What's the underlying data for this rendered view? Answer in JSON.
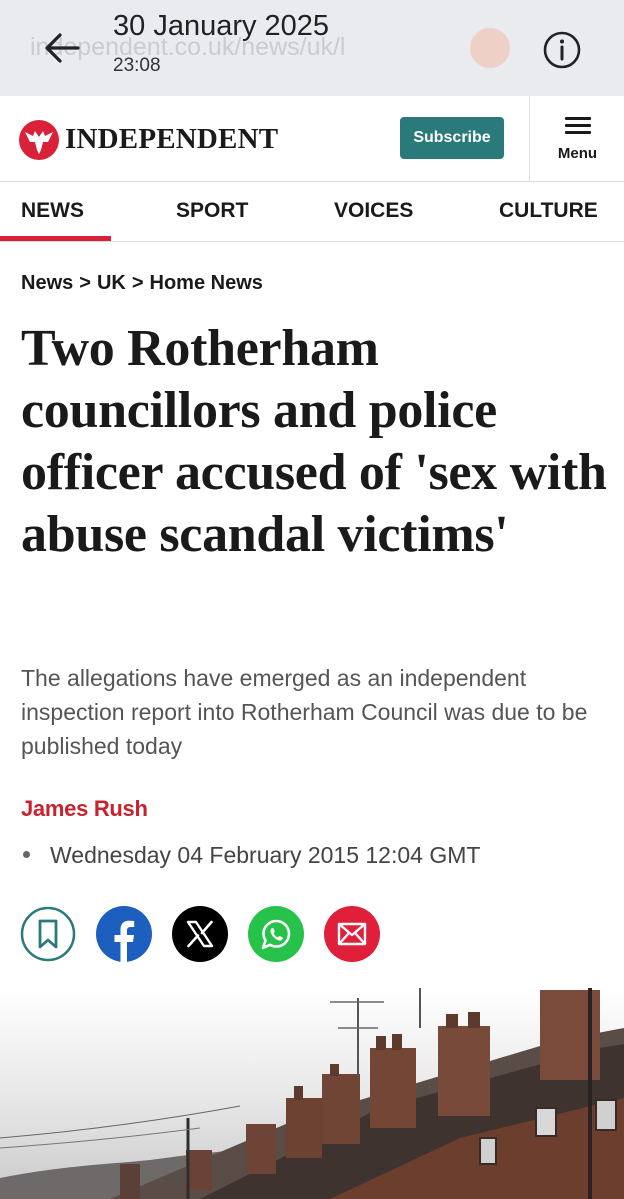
{
  "viewer": {
    "date": "30 January 2025",
    "time": "23:08",
    "ghost_url": "independent.co.uk/news/uk/l"
  },
  "header": {
    "brand": "INDEPENDENT",
    "subscribe_label": "Subscribe",
    "menu_label": "Menu",
    "accent_color": "#d9213a",
    "subscribe_color": "#2a7a7b"
  },
  "nav": {
    "items": [
      "NEWS",
      "SPORT",
      "VOICES",
      "CULTURE"
    ],
    "active": "NEWS"
  },
  "article": {
    "breadcrumb": [
      "News",
      "UK",
      "Home News"
    ],
    "headline": "Two Rotherham councillors and police officer accused of 'sex with abuse scandal victims'",
    "standfirst": "The allegations have emerged as an independent inspection report into Rotherham Council was due to be published today",
    "author": "James Rush",
    "published": "Wednesday 04 February 2015 12:04 GMT"
  },
  "share_icons": [
    {
      "name": "bookmark-icon",
      "color": "#2a7a7b"
    },
    {
      "name": "facebook-icon",
      "color": "#1d5fbf"
    },
    {
      "name": "x-icon",
      "color": "#000000"
    },
    {
      "name": "whatsapp-icon",
      "color": "#27c24a"
    },
    {
      "name": "email-icon",
      "color": "#e0203a"
    }
  ]
}
